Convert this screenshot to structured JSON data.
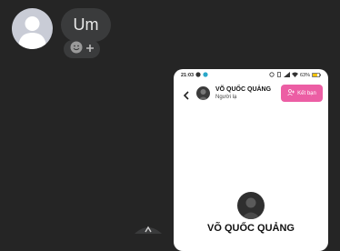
{
  "chat": {
    "message_text": "Um"
  },
  "shared_screenshot": {
    "status_bar": {
      "time": "21:03",
      "battery": "63%"
    },
    "header": {
      "name": "VÕ QUỐC QUẢNG",
      "subtitle": "Người lạ",
      "add_friend_label": "Kết bạn"
    },
    "profile": {
      "name": "VÕ QUỐC QUẢNG"
    }
  },
  "colors": {
    "background": "#252525",
    "bubble": "#3a3b3c",
    "accent_pink": "#ec5ea4"
  },
  "icons": [
    "default-avatar-icon",
    "smiley-reaction-icon",
    "plus-icon",
    "back-arrow-icon",
    "add-friend-icon",
    "share-icon"
  ]
}
